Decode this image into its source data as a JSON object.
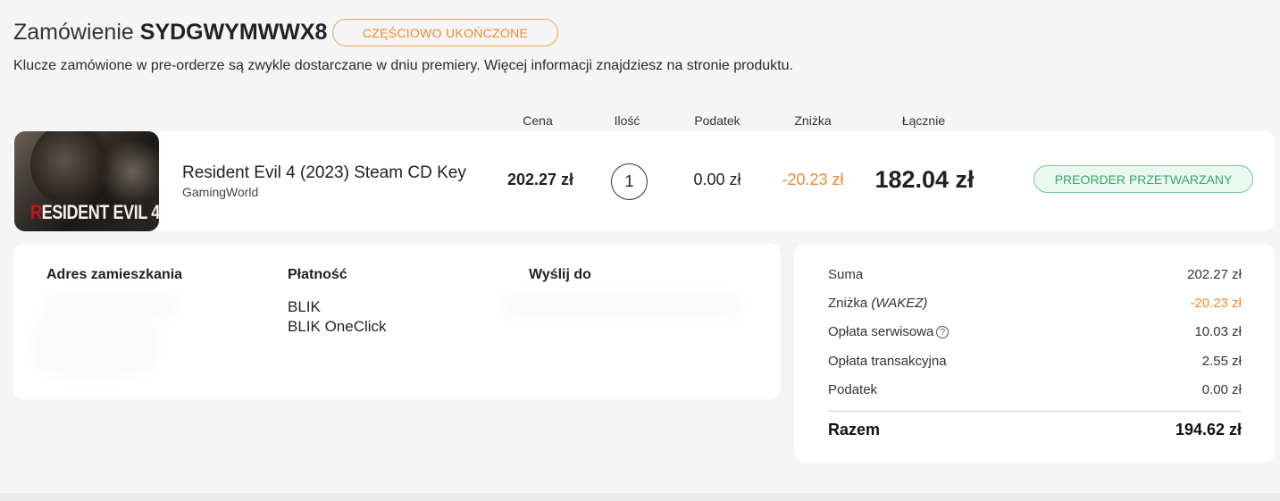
{
  "order": {
    "title_prefix": "Zamówienie",
    "code": "SYDGWYMWWX8",
    "status": "CZĘŚCIOWO UKOŃCZONE",
    "info": "Klucze zamówione w pre-orderze są zwykle dostarczane w dniu premiery. Więcej informacji znajdziesz na stronie produktu."
  },
  "columns": {
    "price": "Cena",
    "quantity": "Ilość",
    "tax": "Podatek",
    "discount": "Zniżka",
    "total": "Łącznie"
  },
  "product": {
    "thumbnail_logo_red": "R",
    "thumbnail_logo_rest": "ESIDENT EVIL 4",
    "name": "Resident Evil 4 (2023) Steam CD Key",
    "seller": "GamingWorld",
    "price": "202.27 zł",
    "quantity": "1",
    "tax": "0.00 zł",
    "discount": "-20.23 zł",
    "total": "182.04 zł",
    "status": "PREORDER PRZETWARZANY"
  },
  "details": {
    "address_heading": "Adres zamieszkania",
    "payment_heading": "Płatność",
    "payment_method": "BLIK",
    "payment_submethod": "BLIK OneClick",
    "ship_heading": "Wyślij do"
  },
  "summary": {
    "subtotal_label": "Suma",
    "subtotal_value": "202.27 zł",
    "discount_label": "Zniżka",
    "discount_code": "(WAKEZ)",
    "discount_value": "-20.23 zł",
    "service_fee_label": "Opłata serwisowa",
    "service_fee_value": "10.03 zł",
    "transaction_fee_label": "Opłata transakcyjna",
    "transaction_fee_value": "2.55 zł",
    "tax_label": "Podatek",
    "tax_value": "0.00 zł",
    "total_label": "Razem",
    "total_value": "194.62 zł"
  },
  "icons": {
    "help": "?"
  },
  "colors": {
    "accent_orange": "#ef8a2c",
    "status_green": "#35a86c"
  }
}
